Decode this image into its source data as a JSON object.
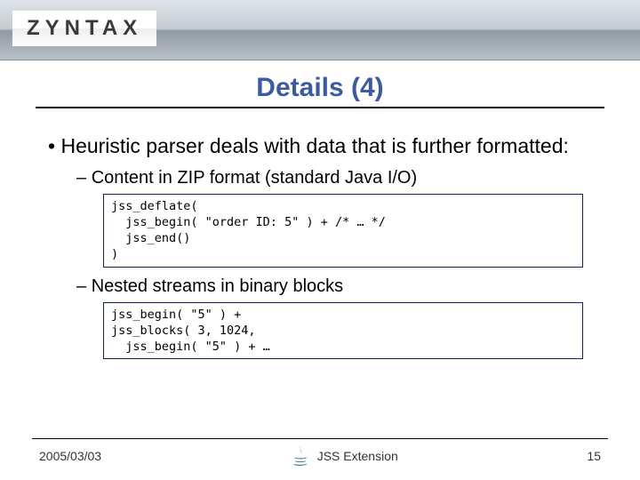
{
  "logo": "ZYNTAX",
  "title": "Details (4)",
  "bullets": {
    "main": "Heuristic parser deals with data that is further formatted:",
    "sub1": "Content in ZIP format (standard Java I/O)",
    "sub2": "Nested streams in binary blocks"
  },
  "code1": "jss_deflate(\n  jss_begin( \"order ID: 5\" ) + /* … */\n  jss_end()\n)",
  "code2": "jss_begin( \"5\" ) +\njss_blocks( 3, 1024,\n  jss_begin( \"5\" ) + …",
  "footer": {
    "date": "2005/03/03",
    "center": "JSS Extension",
    "page": "15"
  }
}
